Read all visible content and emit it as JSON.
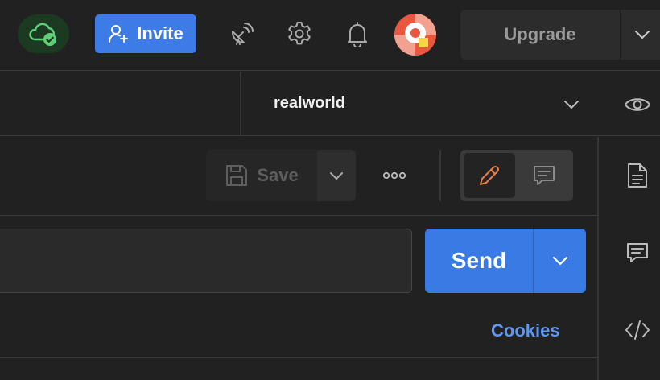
{
  "header": {
    "invite_label": "Invite",
    "upgrade_label": "Upgrade",
    "icons": [
      "cloud-synced-icon",
      "user-plus-icon",
      "satellite-icon",
      "settings-icon",
      "bell-icon",
      "avatar",
      "chevron-down-icon"
    ]
  },
  "environment": {
    "selected": "realworld"
  },
  "request": {
    "save_label": "Save",
    "url_value": "",
    "send_label": "Send",
    "cookies_label": "Cookies"
  },
  "colors": {
    "accent": "#3d7ce6",
    "send": "#3a7ae4",
    "link": "#5e98f2",
    "sync_bg": "#1c3a22",
    "sync_icon": "#5fcf78",
    "edit_icon": "#e8804a",
    "background": "#212121"
  }
}
